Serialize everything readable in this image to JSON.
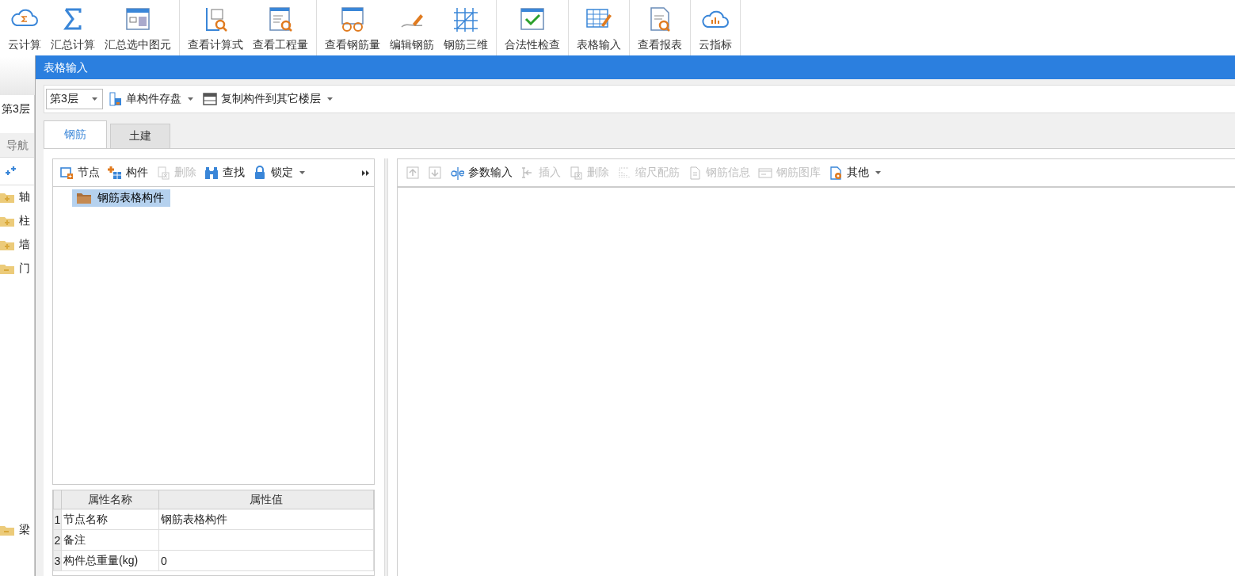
{
  "ribbon": {
    "groups": [
      {
        "buttons": [
          {
            "label": "云计算"
          },
          {
            "label": "汇总计算"
          },
          {
            "label": "汇总选中图元"
          }
        ]
      },
      {
        "buttons": [
          {
            "label": "查看计算式"
          },
          {
            "label": "查看工程量"
          }
        ]
      },
      {
        "buttons": [
          {
            "label": "查看钢筋量"
          },
          {
            "label": "编辑钢筋"
          },
          {
            "label": "钢筋三维"
          }
        ]
      },
      {
        "buttons": [
          {
            "label": "合法性检查"
          }
        ]
      },
      {
        "buttons": [
          {
            "label": "表格输入"
          }
        ]
      },
      {
        "buttons": [
          {
            "label": "查看报表"
          }
        ]
      },
      {
        "buttons": [
          {
            "label": "云指标"
          }
        ]
      }
    ]
  },
  "nav_panel": {
    "floor": "第3层",
    "header": "导航",
    "items": [
      {
        "label": "轴",
        "expanded": false
      },
      {
        "label": "柱",
        "expanded": false
      },
      {
        "label": "墙",
        "expanded": false
      },
      {
        "label": "门",
        "expanded": true
      },
      {
        "label": "梁",
        "expanded": true
      }
    ]
  },
  "dialog": {
    "title": "表格输入",
    "toolbar": {
      "floor_select": {
        "value": "第3层"
      },
      "buttons": [
        {
          "label": "单构件存盘",
          "dropdown": true
        },
        {
          "label": "复制构件到其它楼层",
          "dropdown": true
        }
      ]
    },
    "tabs": [
      {
        "label": "钢筋",
        "selected": true
      },
      {
        "label": "土建",
        "selected": false
      }
    ],
    "left_toolbar": [
      {
        "label": "节点",
        "disabled": false,
        "dropdown": false
      },
      {
        "label": "构件",
        "disabled": false,
        "dropdown": false
      },
      {
        "label": "删除",
        "disabled": true,
        "dropdown": false
      },
      {
        "label": "查找",
        "disabled": false,
        "dropdown": false
      },
      {
        "label": "锁定",
        "disabled": false,
        "dropdown": true
      }
    ],
    "tree": [
      {
        "label": "钢筋表格构件",
        "selected": true
      }
    ],
    "property_grid": {
      "columns": [
        "属性名称",
        "属性值"
      ],
      "rows": [
        {
          "index": "1",
          "name": "节点名称",
          "value": "钢筋表格构件"
        },
        {
          "index": "2",
          "name": "备注"
        },
        {
          "index": "3",
          "name": "构件总重量(kg)",
          "value": "0"
        }
      ]
    },
    "right_toolbar": [
      {
        "disabled": true,
        "dropdown": false
      },
      {
        "disabled": true,
        "dropdown": false
      },
      {
        "label": "参数输入",
        "disabled": false,
        "dropdown": false
      },
      {
        "label": "插入",
        "disabled": true,
        "dropdown": false
      },
      {
        "label": "删除",
        "disabled": true,
        "dropdown": false
      },
      {
        "label": "缩尺配筋",
        "disabled": true,
        "dropdown": false
      },
      {
        "label": "钢筋信息",
        "disabled": true,
        "dropdown": false
      },
      {
        "label": "钢筋图库",
        "disabled": true,
        "dropdown": false
      },
      {
        "label": "其他",
        "disabled": false,
        "dropdown": true
      }
    ]
  }
}
